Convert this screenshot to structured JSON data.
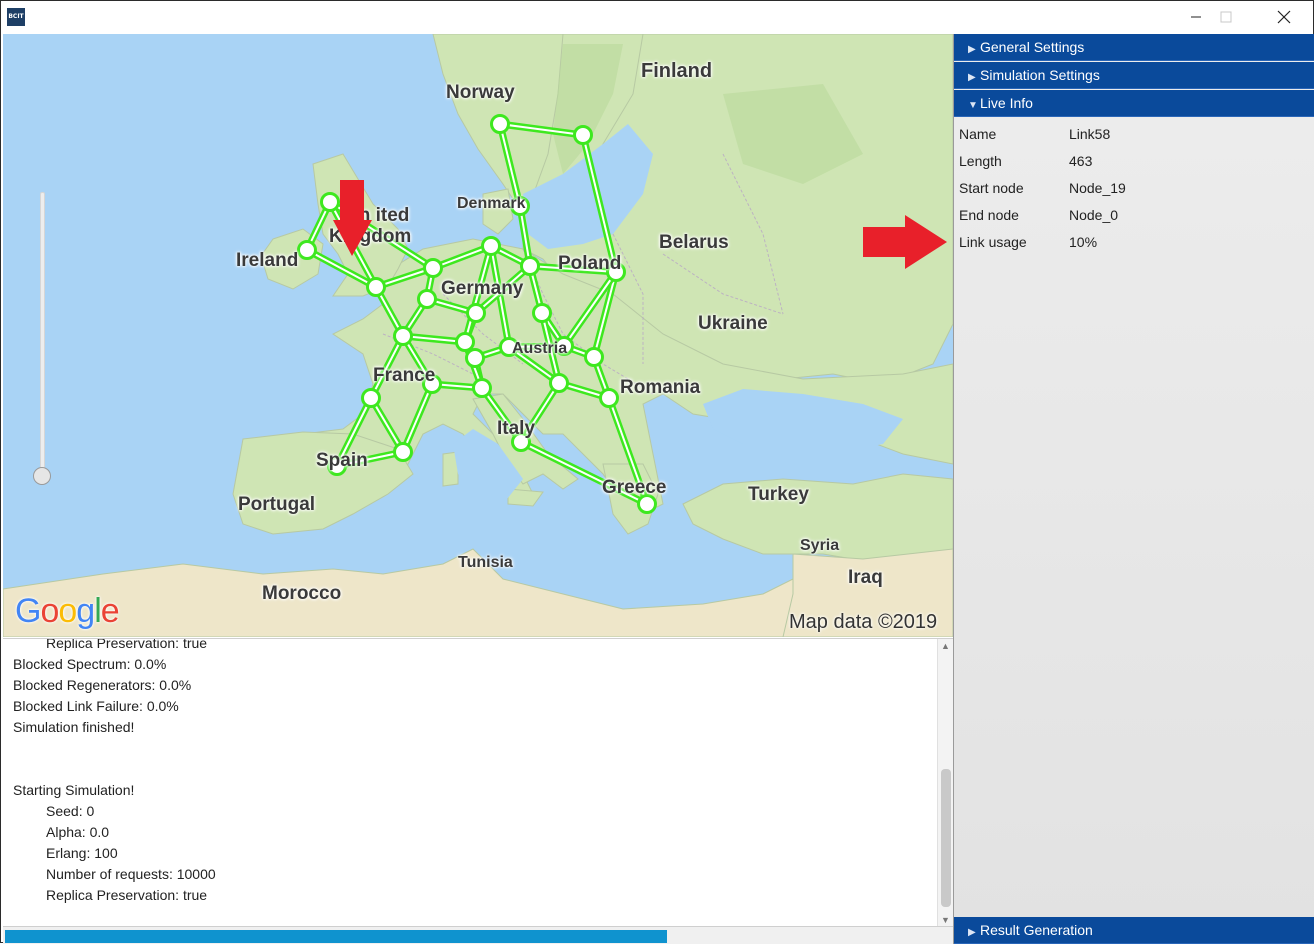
{
  "app": {
    "icon_text": "BCIT"
  },
  "window_controls": {
    "minimize": "—",
    "maximize": "☐",
    "close": "✕"
  },
  "map": {
    "countries": {
      "finland": "Finland",
      "norway": "Norway",
      "united_kingdom_1": "Un  ited",
      "united_kingdom_2": "Kingdom",
      "ireland": "Ireland",
      "denmark": "Denmark",
      "belarus": "Belarus",
      "germany": "Germany",
      "poland": "Poland",
      "ukraine": "Ukraine",
      "france": "France",
      "austria": "Austria",
      "romania": "Romania",
      "italy": "Italy",
      "spain": "Spain",
      "portugal": "Portugal",
      "greece": "Greece",
      "turkey": "Turkey",
      "syria": "Syria",
      "iraq": "Iraq",
      "tunisia": "Tunisia",
      "morocco": "Morocco"
    },
    "attribution": "Map data ©2019",
    "logo": [
      "G",
      "o",
      "o",
      "g",
      "l",
      "e"
    ],
    "logo_colors": [
      "#4285f4",
      "#ea4335",
      "#fbbc05",
      "#4285f4",
      "#34a853",
      "#ea4335"
    ],
    "colors": {
      "sea": "#a9d3f5",
      "land": "#cfe5b4",
      "network": "#3ee81f",
      "arrow": "#e8202a"
    },
    "zoom_level": 0.0
  },
  "console": {
    "lines": [
      {
        "text": "Replica Preservation: true",
        "indent": true
      },
      {
        "text": "Blocked Spectrum: 0.0%",
        "indent": false
      },
      {
        "text": "Blocked Regenerators: 0.0%",
        "indent": false
      },
      {
        "text": "Blocked Link Failure: 0.0%",
        "indent": false
      },
      {
        "text": "Simulation finished!",
        "indent": false
      },
      {
        "text": "",
        "indent": false
      },
      {
        "text": "",
        "indent": false
      },
      {
        "text": "Starting Simulation!",
        "indent": false
      },
      {
        "text": "Seed: 0",
        "indent": true
      },
      {
        "text": "Alpha: 0.0",
        "indent": true
      },
      {
        "text": "Erlang: 100",
        "indent": true
      },
      {
        "text": "Number of requests: 10000",
        "indent": true
      },
      {
        "text": "Replica Preservation: true",
        "indent": true
      }
    ]
  },
  "progress": {
    "value": 0.7
  },
  "sidebar": {
    "general_settings": "General Settings",
    "simulation_settings": "Simulation Settings",
    "live_info": "Live Info",
    "result_generation": "Result Generation",
    "info_rows": [
      {
        "key": "Name",
        "value": "Link58"
      },
      {
        "key": "Length",
        "value": "463"
      },
      {
        "key": "Start node",
        "value": "Node_19"
      },
      {
        "key": "End node",
        "value": "Node_0"
      },
      {
        "key": "Link usage",
        "value": "10%"
      }
    ]
  }
}
